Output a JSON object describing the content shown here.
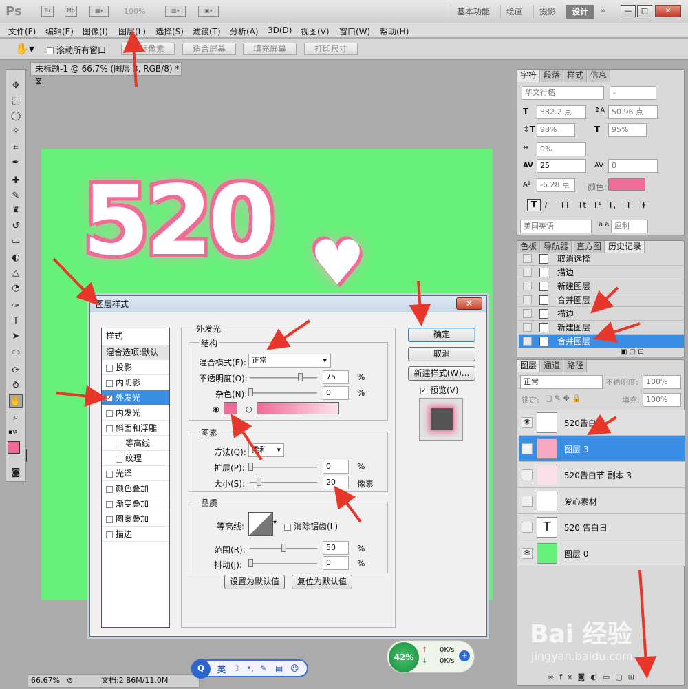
{
  "app": {
    "logo": "Ps",
    "icons": [
      "Br",
      "Mb"
    ],
    "zoom": "100%"
  },
  "workspaces": [
    "基本功能",
    "绘画",
    "摄影",
    "设计"
  ],
  "window_buttons": [
    "—",
    "□",
    "✕"
  ],
  "menu": [
    "文件(F)",
    "编辑(E)",
    "图像(I)",
    "图层(L)",
    "选择(S)",
    "滤镜(T)",
    "分析(A)",
    "3D(D)",
    "视图(V)",
    "窗口(W)",
    "帮助(H)"
  ],
  "options": {
    "scroll_all": "滚动所有窗口",
    "buttons": [
      "实际像素",
      "适合屏幕",
      "填充屏幕",
      "打印尺寸"
    ]
  },
  "doc_tab": "未标题-1 @ 66.7% (图层 3, RGB/8) *",
  "status": {
    "zoom": "66.67%",
    "doc": "文档:2.86M/11.0M"
  },
  "char_panel": {
    "tabs": [
      "字符",
      "段落",
      "样式",
      "信息"
    ],
    "font": "华文行楷",
    "style": "-",
    "size": "382.2 点",
    "leading": "50.96 点",
    "vscale": "98%",
    "hscale": "95%",
    "tsume": "0%",
    "kerning": "25",
    "tracking": "0",
    "baseline": "-6.28 点",
    "color_label": "颜色:",
    "lang": "美国英语",
    "aa_label": "a a",
    "aa": "犀利",
    "type_buttons": [
      "T",
      "T",
      "TT",
      "Tt",
      "T¹",
      "T,",
      "T",
      "Ŧ"
    ]
  },
  "history": {
    "tabs": [
      "色板",
      "导航器",
      "直方图",
      "历史记录"
    ],
    "items": [
      "取消选择",
      "描边",
      "新建图层",
      "合并图层",
      "描边",
      "新建图层",
      "合并图层"
    ]
  },
  "layers": {
    "tabs": [
      "图层",
      "通道",
      "路径"
    ],
    "mode": "正常",
    "opacity_label": "不透明度:",
    "opacity": "100%",
    "lock_label": "锁定:",
    "fill_label": "填充:",
    "fill": "100%",
    "items": [
      "520告白节",
      "图层 3",
      "520告白节 副本 3",
      "爱心素材",
      "520        告白日",
      "图层 0"
    ],
    "text_icon": "T"
  },
  "dialog": {
    "title": "图层样式",
    "close": "✕",
    "styles_header": "样式",
    "blend_item": "混合选项:默认",
    "styles": [
      "投影",
      "内阴影",
      "外发光",
      "内发光",
      "斜面和浮雕",
      "等高线",
      "纹理",
      "光泽",
      "颜色叠加",
      "渐变叠加",
      "图案叠加",
      "描边"
    ],
    "outer_glow": "外发光",
    "structure": "结构",
    "blend_mode_label": "混合模式(E):",
    "blend_mode": "正常",
    "opacity_label": "不透明度(O):",
    "opacity": "75",
    "pct": "%",
    "noise_label": "杂色(N):",
    "noise": "0",
    "elements": "图素",
    "method_label": "方法(Q):",
    "method": "柔和",
    "spread_label": "扩展(P):",
    "spread": "0",
    "size_label": "大小(S):",
    "size": "20",
    "px": "像素",
    "quality": "品质",
    "contour_label": "等高线:",
    "antialias": "消除锯齿(L)",
    "range_label": "范围(R):",
    "range": "50",
    "jitter_label": "抖动(J):",
    "jitter": "0",
    "set_default": "设置为默认值",
    "reset_default": "复位为默认值",
    "ok": "确定",
    "cancel": "取消",
    "new_style": "新建样式(W)...",
    "preview": "预览(V)"
  },
  "taskbar": {
    "ime": "英",
    "ime_icons": [
      "☽",
      "•,",
      "✎",
      "▤",
      "☺"
    ],
    "perf": "42%",
    "up": "0K/s",
    "down": "0K/s"
  },
  "watermark": {
    "logo": "Bai 经验",
    "url": "jingyan.baidu.com"
  },
  "colors": {
    "canvas": "#66f17a",
    "glow": "#f06b95",
    "selection": "#3a8ee6",
    "arrow": "#e8362a"
  }
}
